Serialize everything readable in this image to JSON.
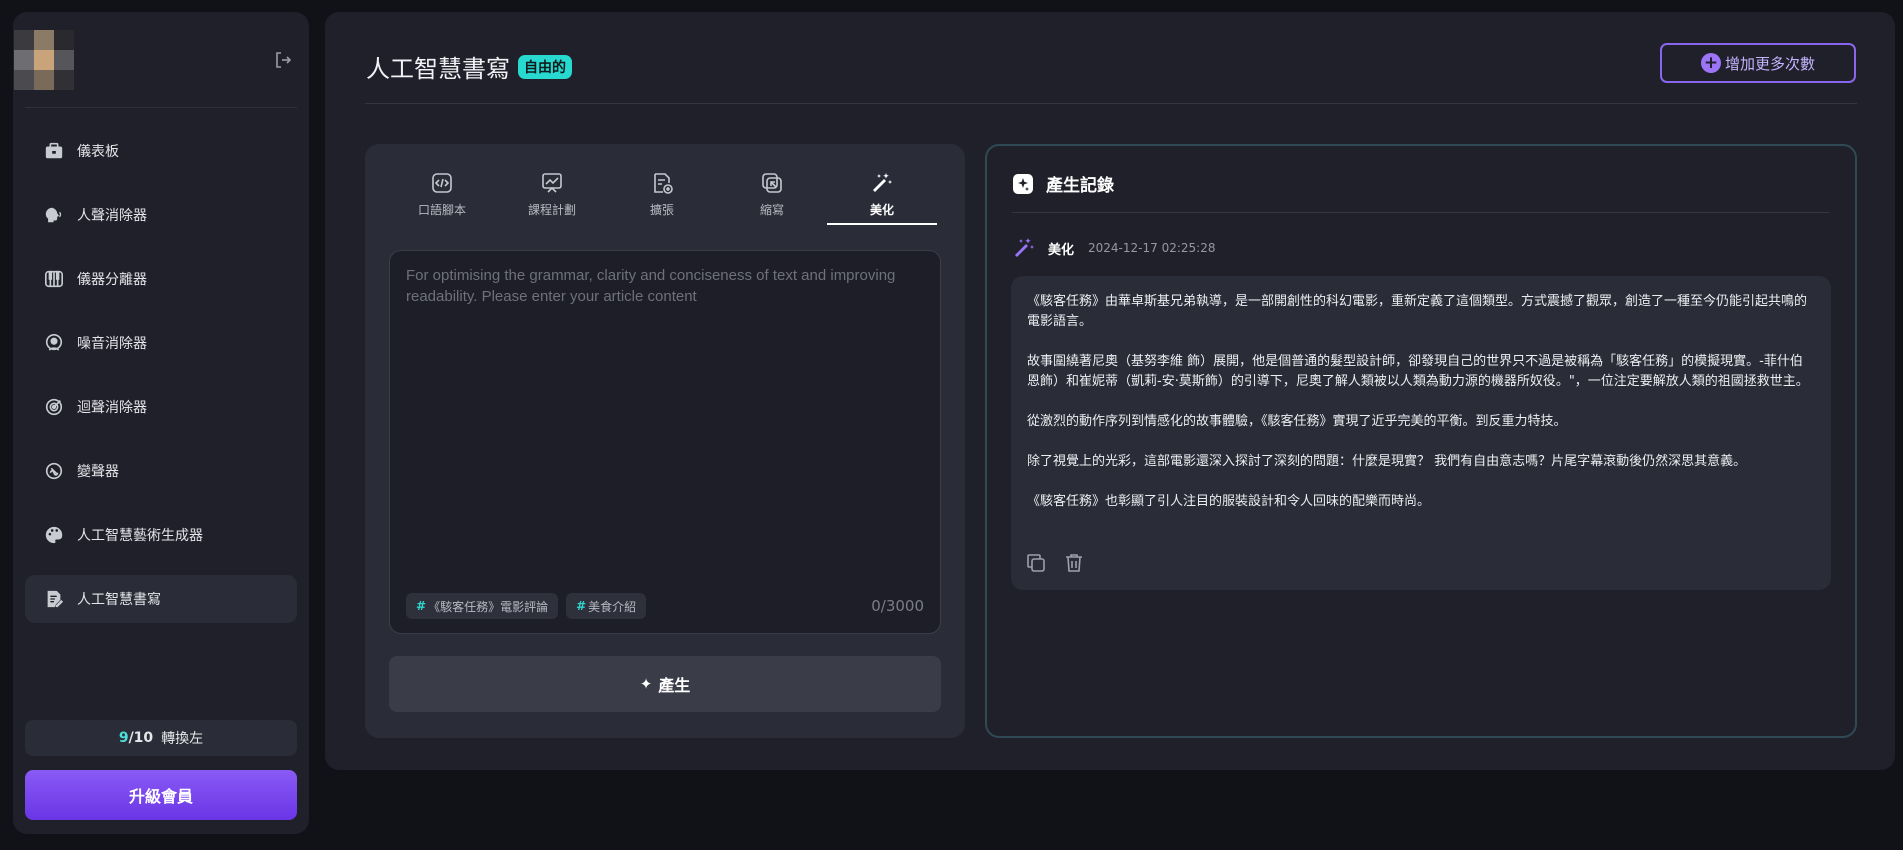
{
  "sidebar": {
    "items": [
      {
        "label": "儀表板",
        "icon": "briefcase-icon"
      },
      {
        "label": "人聲消除器",
        "icon": "voice-icon"
      },
      {
        "label": "儀器分離器",
        "icon": "piano-icon"
      },
      {
        "label": "噪音消除器",
        "icon": "noise-icon"
      },
      {
        "label": "迴聲消除器",
        "icon": "echo-icon"
      },
      {
        "label": "變聲器",
        "icon": "voice-changer-icon"
      },
      {
        "label": "人工智慧藝術生成器",
        "icon": "palette-icon"
      },
      {
        "label": "人工智慧書寫",
        "icon": "writing-icon"
      }
    ],
    "active_index": 7,
    "credits": {
      "used": "9",
      "total": "/10",
      "unit": "轉換左"
    },
    "upgrade_label": "升級會員"
  },
  "header": {
    "title": "人工智慧書寫",
    "badge": "自由的",
    "add_button": "增加更多次數"
  },
  "editor": {
    "tabs": [
      {
        "label": "口語腳本",
        "icon": "code-file-icon"
      },
      {
        "label": "課程計劃",
        "icon": "chart-board-icon"
      },
      {
        "label": "擴張",
        "icon": "document-add-icon"
      },
      {
        "label": "縮寫",
        "icon": "shrink-icon"
      },
      {
        "label": "美化",
        "icon": "magic-wand-icon"
      }
    ],
    "active_tab": 4,
    "placeholder": "For optimising the grammar, clarity and conciseness of text and improving readability. Please enter your article content",
    "value": "",
    "chips": [
      "《駭客任務》電影評論",
      "美食介紹"
    ],
    "counter": "0/3000",
    "generate_label": "產生"
  },
  "history": {
    "title": "產生記錄",
    "entry": {
      "type": "美化",
      "timestamp": "2024-12-17 02:25:28",
      "paragraphs": [
        "《駭客任務》由華卓斯基兄弟執導，是一部開創性的科幻電影，重新定義了這個類型。方式震撼了觀眾，創造了一種至今仍能引起共鳴的電影語言。",
        "故事圍繞著尼奧（基努李維 飾）展開，他是個普通的髮型設計師，卻發現自己的世界只不過是被稱為「駭客任務」的模擬現實。-菲什伯恩飾）和崔妮蒂（凱莉-安·莫斯飾）的引導下，尼奧了解人類被以人類為動力源的機器所奴役。\"，一位注定要解放人類的祖國拯救世主。",
        "從激烈的動作序列到情感化的故事體驗，《駭客任務》實現了近乎完美的平衡。到反重力特技。",
        "除了視覺上的光彩，這部電影還深入探討了深刻的問題：什麼是現實？ 我們有自由意志嗎？片尾字幕滾動後仍然深思其意義。",
        "《駭客任務》也彰顯了引人注目的服裝設計和令人回味的配樂而時尚。"
      ]
    }
  }
}
